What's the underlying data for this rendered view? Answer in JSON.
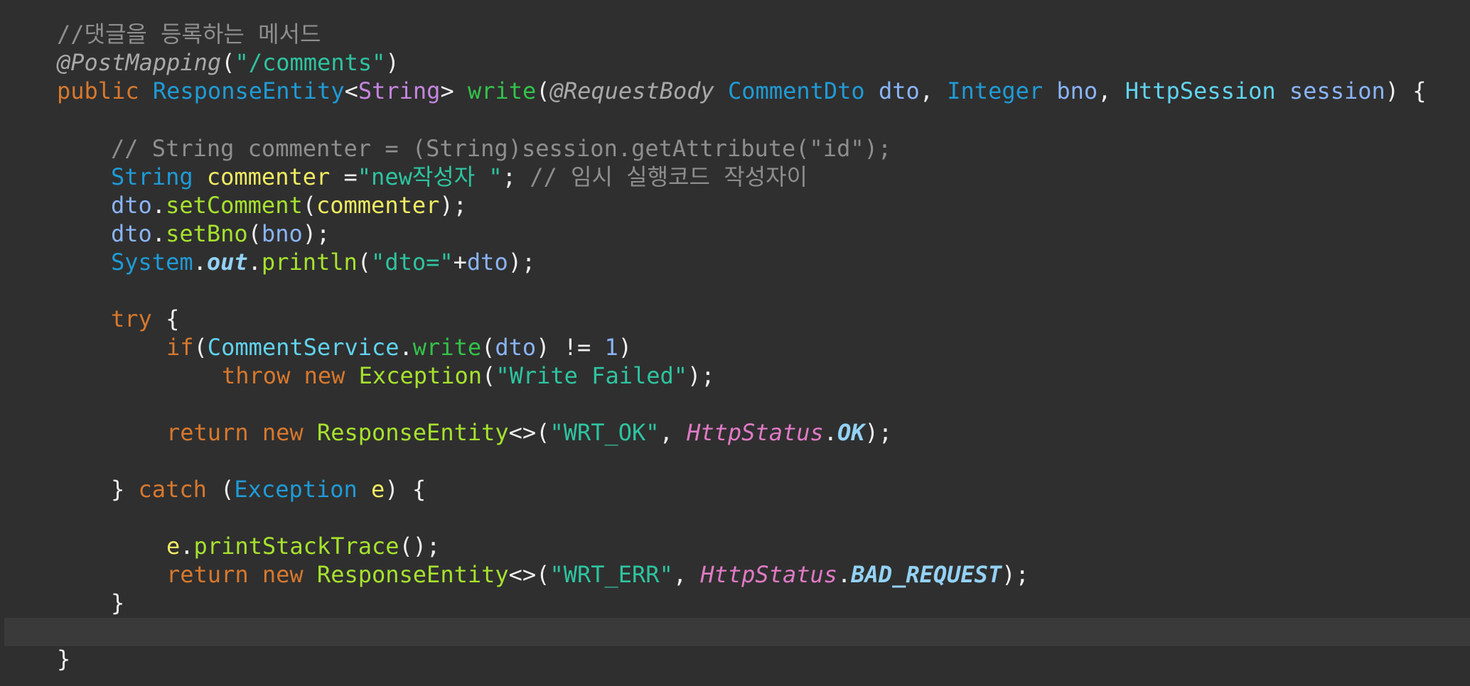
{
  "editor": {
    "colors": {
      "background": "#2f2f2f",
      "current_line": "#3a3a3a"
    },
    "lines": [
      {
        "id": "line-1",
        "indent": 1,
        "tokens": [
          {
            "t": "//댓글을 등록하는 메서드",
            "k": "comment"
          }
        ]
      },
      {
        "id": "line-2",
        "indent": 1,
        "tokens": [
          {
            "t": "@PostMapping",
            "k": "annotation"
          },
          {
            "t": "(",
            "k": "plain"
          },
          {
            "t": "\"/comments\"",
            "k": "string"
          },
          {
            "t": ")",
            "k": "plain"
          }
        ]
      },
      {
        "id": "line-3",
        "indent": 1,
        "tokens": [
          {
            "t": "public ",
            "k": "keyword"
          },
          {
            "t": "ResponseEntity",
            "k": "type"
          },
          {
            "t": "<",
            "k": "plain"
          },
          {
            "t": "String",
            "k": "generic"
          },
          {
            "t": "> ",
            "k": "plain"
          },
          {
            "t": "write",
            "k": "method"
          },
          {
            "t": "(",
            "k": "plain"
          },
          {
            "t": "@RequestBody ",
            "k": "annotation"
          },
          {
            "t": "CommentDto ",
            "k": "type"
          },
          {
            "t": "dto",
            "k": "var"
          },
          {
            "t": ", ",
            "k": "plain"
          },
          {
            "t": "Integer ",
            "k": "type"
          },
          {
            "t": "bno",
            "k": "var"
          },
          {
            "t": ", ",
            "k": "plain"
          },
          {
            "t": "HttpSession ",
            "k": "typeb"
          },
          {
            "t": "session",
            "k": "var"
          },
          {
            "t": ") {",
            "k": "plain"
          }
        ]
      },
      {
        "id": "line-4",
        "indent": 0,
        "tokens": []
      },
      {
        "id": "line-5",
        "indent": 2,
        "tokens": [
          {
            "t": "// String commenter = (String)session.getAttribute(\"id\");",
            "k": "comment"
          }
        ]
      },
      {
        "id": "line-6",
        "indent": 2,
        "tokens": [
          {
            "t": "String ",
            "k": "type"
          },
          {
            "t": "commenter",
            "k": "local"
          },
          {
            "t": " =",
            "k": "plain"
          },
          {
            "t": "\"new작성자 \"",
            "k": "string"
          },
          {
            "t": "; ",
            "k": "plain"
          },
          {
            "t": "// 임시 실행코드 작성자이",
            "k": "comment"
          }
        ]
      },
      {
        "id": "line-7",
        "indent": 2,
        "tokens": [
          {
            "t": "dto",
            "k": "var"
          },
          {
            "t": ".",
            "k": "plain"
          },
          {
            "t": "setComment",
            "k": "method2"
          },
          {
            "t": "(",
            "k": "plain"
          },
          {
            "t": "commenter",
            "k": "local"
          },
          {
            "t": ");",
            "k": "plain"
          }
        ]
      },
      {
        "id": "line-8",
        "indent": 2,
        "tokens": [
          {
            "t": "dto",
            "k": "var"
          },
          {
            "t": ".",
            "k": "plain"
          },
          {
            "t": "setBno",
            "k": "method2"
          },
          {
            "t": "(",
            "k": "plain"
          },
          {
            "t": "bno",
            "k": "var"
          },
          {
            "t": ");",
            "k": "plain"
          }
        ]
      },
      {
        "id": "line-9",
        "indent": 2,
        "tokens": [
          {
            "t": "System",
            "k": "type"
          },
          {
            "t": ".",
            "k": "plain"
          },
          {
            "t": "out",
            "k": "static-field"
          },
          {
            "t": ".",
            "k": "plain"
          },
          {
            "t": "println",
            "k": "method2"
          },
          {
            "t": "(",
            "k": "plain"
          },
          {
            "t": "\"dto=\"",
            "k": "string"
          },
          {
            "t": "+",
            "k": "plain"
          },
          {
            "t": "dto",
            "k": "var"
          },
          {
            "t": ");",
            "k": "plain"
          }
        ]
      },
      {
        "id": "line-10",
        "indent": 0,
        "tokens": []
      },
      {
        "id": "line-11",
        "indent": 2,
        "tokens": [
          {
            "t": "try ",
            "k": "keyword"
          },
          {
            "t": "{",
            "k": "plain"
          }
        ]
      },
      {
        "id": "line-12",
        "indent": 3,
        "tokens": [
          {
            "t": "if",
            "k": "keyword"
          },
          {
            "t": "(",
            "k": "plain"
          },
          {
            "t": "CommentService",
            "k": "typeb"
          },
          {
            "t": ".",
            "k": "plain"
          },
          {
            "t": "write",
            "k": "method"
          },
          {
            "t": "(",
            "k": "plain"
          },
          {
            "t": "dto",
            "k": "var"
          },
          {
            "t": ") != ",
            "k": "plain"
          },
          {
            "t": "1",
            "k": "number"
          },
          {
            "t": ")",
            "k": "plain"
          }
        ]
      },
      {
        "id": "line-13",
        "indent": 4,
        "tokens": [
          {
            "t": "throw ",
            "k": "keyword"
          },
          {
            "t": "new ",
            "k": "keyword"
          },
          {
            "t": "Exception",
            "k": "method2"
          },
          {
            "t": "(",
            "k": "plain"
          },
          {
            "t": "\"Write Failed\"",
            "k": "string"
          },
          {
            "t": ");",
            "k": "plain"
          }
        ]
      },
      {
        "id": "line-14",
        "indent": 0,
        "tokens": []
      },
      {
        "id": "line-15",
        "indent": 3,
        "tokens": [
          {
            "t": "return ",
            "k": "keyword"
          },
          {
            "t": "new ",
            "k": "keyword"
          },
          {
            "t": "ResponseEntity",
            "k": "method2"
          },
          {
            "t": "<>(",
            "k": "plain"
          },
          {
            "t": "\"WRT_OK\"",
            "k": "string"
          },
          {
            "t": ", ",
            "k": "plain"
          },
          {
            "t": "HttpStatus",
            "k": "static-type"
          },
          {
            "t": ".",
            "k": "plain"
          },
          {
            "t": "OK",
            "k": "static-field"
          },
          {
            "t": ");",
            "k": "plain"
          }
        ]
      },
      {
        "id": "line-16",
        "indent": 0,
        "tokens": []
      },
      {
        "id": "line-17",
        "indent": 2,
        "tokens": [
          {
            "t": "} ",
            "k": "plain"
          },
          {
            "t": "catch ",
            "k": "keyword"
          },
          {
            "t": "(",
            "k": "plain"
          },
          {
            "t": "Exception ",
            "k": "type"
          },
          {
            "t": "e",
            "k": "local"
          },
          {
            "t": ") {",
            "k": "plain"
          }
        ]
      },
      {
        "id": "line-18",
        "indent": 0,
        "tokens": []
      },
      {
        "id": "line-19",
        "indent": 3,
        "tokens": [
          {
            "t": "e",
            "k": "local"
          },
          {
            "t": ".",
            "k": "plain"
          },
          {
            "t": "printStackTrace",
            "k": "method2"
          },
          {
            "t": "();",
            "k": "plain"
          }
        ]
      },
      {
        "id": "line-20",
        "indent": 3,
        "tokens": [
          {
            "t": "return ",
            "k": "keyword"
          },
          {
            "t": "new ",
            "k": "keyword"
          },
          {
            "t": "ResponseEntity",
            "k": "method2"
          },
          {
            "t": "<>(",
            "k": "plain"
          },
          {
            "t": "\"WRT_ERR\"",
            "k": "string"
          },
          {
            "t": ", ",
            "k": "plain"
          },
          {
            "t": "HttpStatus",
            "k": "static-type"
          },
          {
            "t": ".",
            "k": "plain"
          },
          {
            "t": "BAD_REQUEST",
            "k": "static-field"
          },
          {
            "t": ");",
            "k": "plain"
          }
        ]
      },
      {
        "id": "line-21",
        "indent": 2,
        "tokens": [
          {
            "t": "}",
            "k": "plain"
          }
        ]
      },
      {
        "id": "line-22",
        "indent": 0,
        "current": true,
        "tokens": []
      },
      {
        "id": "line-23",
        "indent": 1,
        "tokens": [
          {
            "t": "}",
            "k": "plain"
          }
        ]
      }
    ]
  }
}
